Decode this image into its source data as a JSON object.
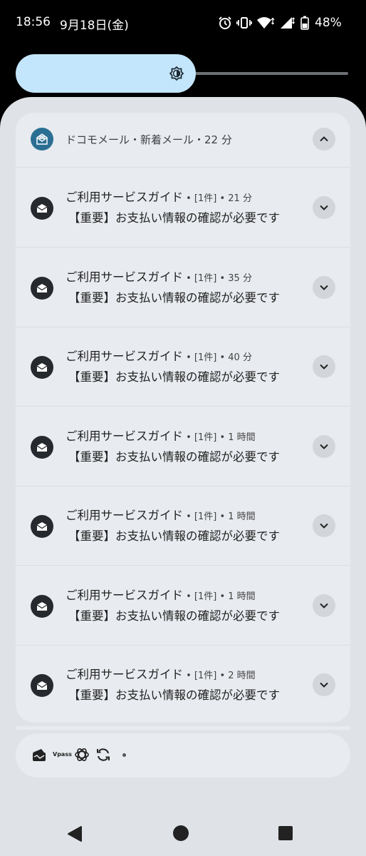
{
  "status_bar": {
    "time": "18:56",
    "date": "9月18日(金)",
    "battery_percent": "48%",
    "icons": [
      "alarm-icon",
      "vibrate-icon",
      "wifi-icon",
      "signal-icon",
      "battery-icon"
    ]
  },
  "brightness": {
    "level": 0.56,
    "icon": "brightness-icon"
  },
  "notification_group": {
    "app_icon": "docomo-mail-icon",
    "header": "ドコモメール・新着メール・22 分",
    "collapse_icon": "chevron-up-icon",
    "items": [
      {
        "sender": "ご利用サービスガイド",
        "meta": " • [1件] • 21 分",
        "subject": "【重要】お支払い情報の確認が必要です"
      },
      {
        "sender": "ご利用サービスガイド",
        "meta": " • [1件] • 35 分",
        "subject": "【重要】お支払い情報の確認が必要です"
      },
      {
        "sender": "ご利用サービスガイド",
        "meta": " • [1件] • 40 分",
        "subject": "【重要】お支払い情報の確認が必要です"
      },
      {
        "sender": "ご利用サービスガイド",
        "meta": " • [1件] • 1 時間",
        "subject": "【重要】お支払い情報の確認が必要です"
      },
      {
        "sender": "ご利用サービスガイド",
        "meta": " • [1件] • 1 時間",
        "subject": "【重要】お支払い情報の確認が必要です"
      },
      {
        "sender": "ご利用サービスガイド",
        "meta": " • [1件] • 1 時間",
        "subject": "【重要】お支払い情報の確認が必要です"
      },
      {
        "sender": "ご利用サービスガイド",
        "meta": " • [1件] • 2 時間",
        "subject": "【重要】お支払い情報の確認が必要です"
      }
    ]
  },
  "notification_shelf": {
    "icons": [
      "wallet-icon",
      "vpass-icon",
      "openai-icon",
      "sync-icon",
      "more-dot-icon"
    ],
    "vpass_label": "Vpass"
  },
  "nav_bar": {
    "buttons": [
      "back-icon",
      "home-icon",
      "recents-icon"
    ]
  },
  "colors": {
    "shade_background": "#dfe2e7",
    "card_background": "#e8ebef",
    "brightness_fill": "#c4e6fd",
    "app_icon_background": "#2a6f93"
  }
}
